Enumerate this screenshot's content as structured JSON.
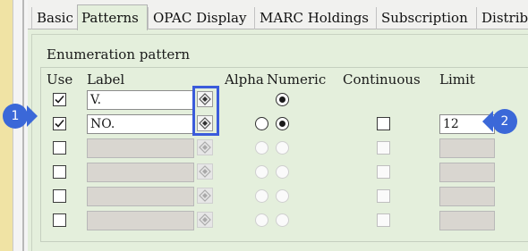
{
  "tabs": [
    "Basic",
    "Patterns",
    "OPAC Display",
    "MARC Holdings",
    "Subscription",
    "Distrib"
  ],
  "active_tab": "Patterns",
  "section_title": "Enumeration pattern",
  "columns": {
    "use": "Use",
    "label": "Label",
    "alpha": "Alpha",
    "numeric": "Numeric",
    "continuous": "Continuous",
    "limit": "Limit"
  },
  "rows": [
    {
      "use": true,
      "label": "V.",
      "enabled": true,
      "alpha": null,
      "numeric": true,
      "continuous": null,
      "limit": null
    },
    {
      "use": true,
      "label": "NO.",
      "enabled": true,
      "alpha": false,
      "numeric": true,
      "continuous": false,
      "limit": "12"
    },
    {
      "use": false,
      "label": "",
      "enabled": false
    },
    {
      "use": false,
      "label": "",
      "enabled": false
    },
    {
      "use": false,
      "label": "",
      "enabled": false
    },
    {
      "use": false,
      "label": "",
      "enabled": false
    }
  ],
  "callouts": [
    "1",
    "2"
  ],
  "colors": {
    "callout": "#3b68d8",
    "highlight": "#3b5bdb",
    "panel_bg": "#e4efdc",
    "left_bar": "#f0e3a4"
  }
}
